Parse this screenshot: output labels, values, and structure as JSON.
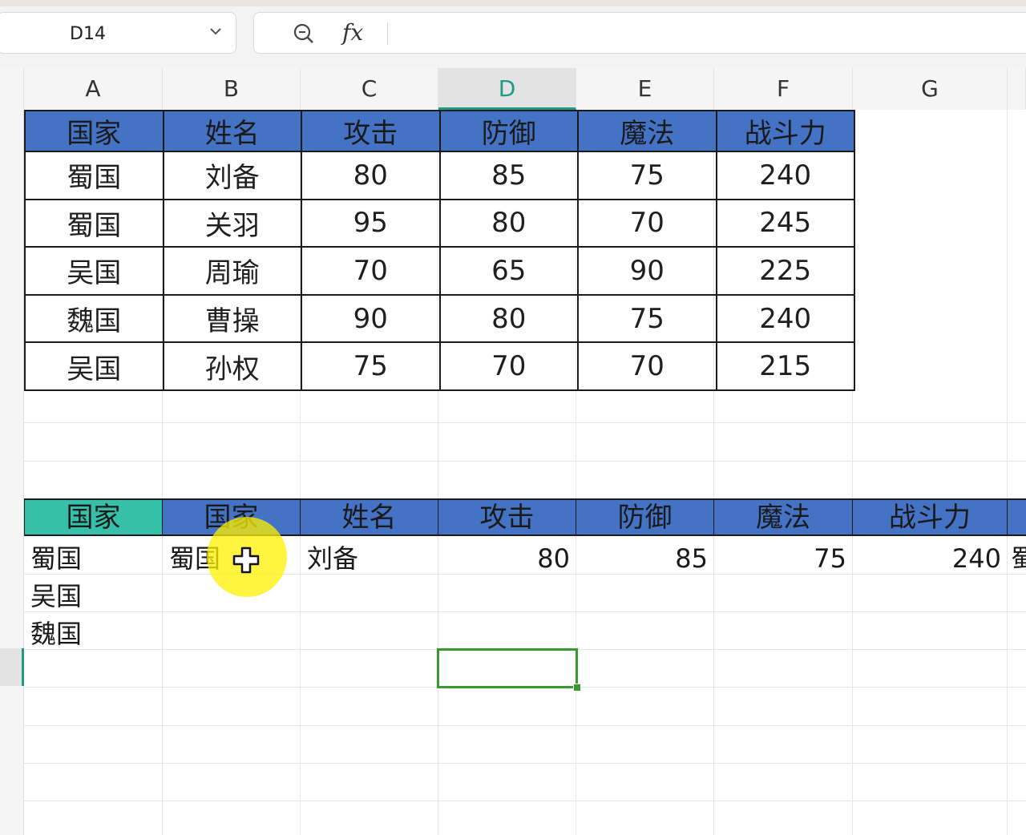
{
  "name_box": {
    "cell_ref": "D14"
  },
  "formula_bar": {
    "fx_label": "fx",
    "content": ""
  },
  "columns": [
    "A",
    "B",
    "C",
    "D",
    "E",
    "F",
    "G"
  ],
  "active_column": "D",
  "table1": {
    "headers": [
      "国家",
      "姓名",
      "攻击",
      "防御",
      "魔法",
      "战斗力"
    ],
    "rows": [
      [
        "蜀国",
        "刘备",
        "80",
        "85",
        "75",
        "240"
      ],
      [
        "蜀国",
        "关羽",
        "95",
        "80",
        "70",
        "245"
      ],
      [
        "吴国",
        "周瑜",
        "70",
        "65",
        "90",
        "225"
      ],
      [
        "魏国",
        "曹操",
        "90",
        "80",
        "75",
        "240"
      ],
      [
        "吴国",
        "孙权",
        "75",
        "70",
        "70",
        "215"
      ]
    ]
  },
  "table2": {
    "headers": [
      "国家",
      "国家",
      "姓名",
      "攻击",
      "防御",
      "魔法",
      "战斗力"
    ],
    "country_list": [
      "蜀国",
      "吴国",
      "魏国"
    ],
    "row1": {
      "country": "蜀国",
      "name": "刘备",
      "attack": "80",
      "defense": "85",
      "magic": "75",
      "power": "240",
      "overflow": "蜀"
    }
  },
  "colors": {
    "header_blue": "#4472c4",
    "header_teal": "#36bfa9",
    "selection_green": "#3a9a2e",
    "active_accent": "#1f9a86"
  }
}
